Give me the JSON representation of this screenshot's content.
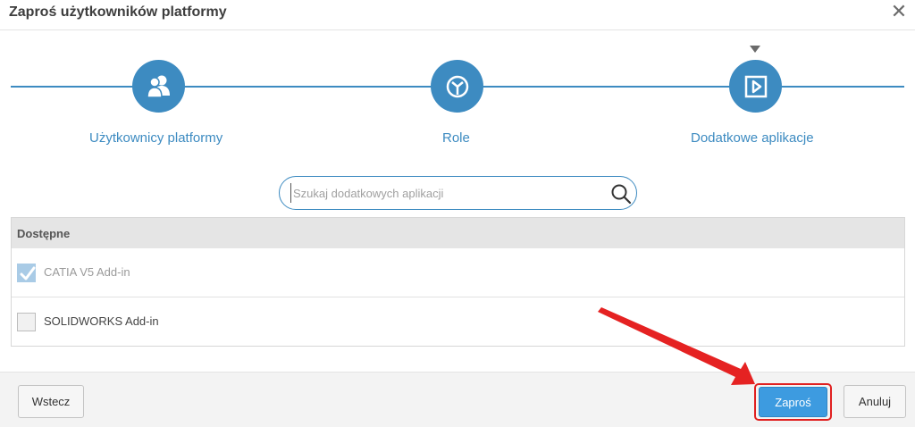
{
  "dialog": {
    "title": "Zaproś użytkowników platformy",
    "close_label": "✕"
  },
  "wizard": {
    "steps": [
      {
        "label": "Użytkownicy platformy",
        "icon": "users-icon"
      },
      {
        "label": "Role",
        "icon": "role-icon"
      },
      {
        "label": "Dodatkowe aplikacje",
        "icon": "app-play-icon",
        "active": true
      }
    ]
  },
  "search": {
    "placeholder": "Szukaj dodatkowych aplikacji",
    "icon": "search-icon"
  },
  "table": {
    "header": "Dostępne",
    "rows": [
      {
        "label": "CATIA V5 Add-in",
        "checked": true,
        "disabled": true
      },
      {
        "label": "SOLIDWORKS Add-in",
        "checked": false
      }
    ]
  },
  "footer": {
    "back_label": "Wstecz",
    "invite_label": "Zaproś",
    "cancel_label": "Anuluj"
  },
  "colors": {
    "accent": "#3d8bc1",
    "primary_button": "#3d9be0",
    "highlight": "#e02020"
  }
}
